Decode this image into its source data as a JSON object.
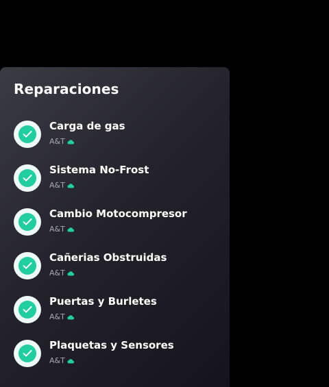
{
  "panel": {
    "title": "Reparaciones"
  },
  "colors": {
    "accent": "#1fcfa0",
    "ring": "#eefbf6",
    "background": "#000000"
  },
  "repairs": [
    {
      "name": "Carga de gas",
      "provider": "A&T",
      "status_icon": "check-icon",
      "provider_icon": "cloud-icon"
    },
    {
      "name": "Sistema No-Frost",
      "provider": "A&T",
      "status_icon": "check-icon",
      "provider_icon": "cloud-icon"
    },
    {
      "name": "Cambio Motocompresor",
      "provider": "A&T",
      "status_icon": "check-icon",
      "provider_icon": "cloud-icon"
    },
    {
      "name": "Cañerias Obstruidas",
      "provider": "A&T",
      "status_icon": "check-icon",
      "provider_icon": "cloud-icon"
    },
    {
      "name": "Puertas y Burletes",
      "provider": "A&T",
      "status_icon": "check-icon",
      "provider_icon": "cloud-icon"
    },
    {
      "name": "Plaquetas y Sensores",
      "provider": "A&T",
      "status_icon": "check-icon",
      "provider_icon": "cloud-icon"
    }
  ]
}
